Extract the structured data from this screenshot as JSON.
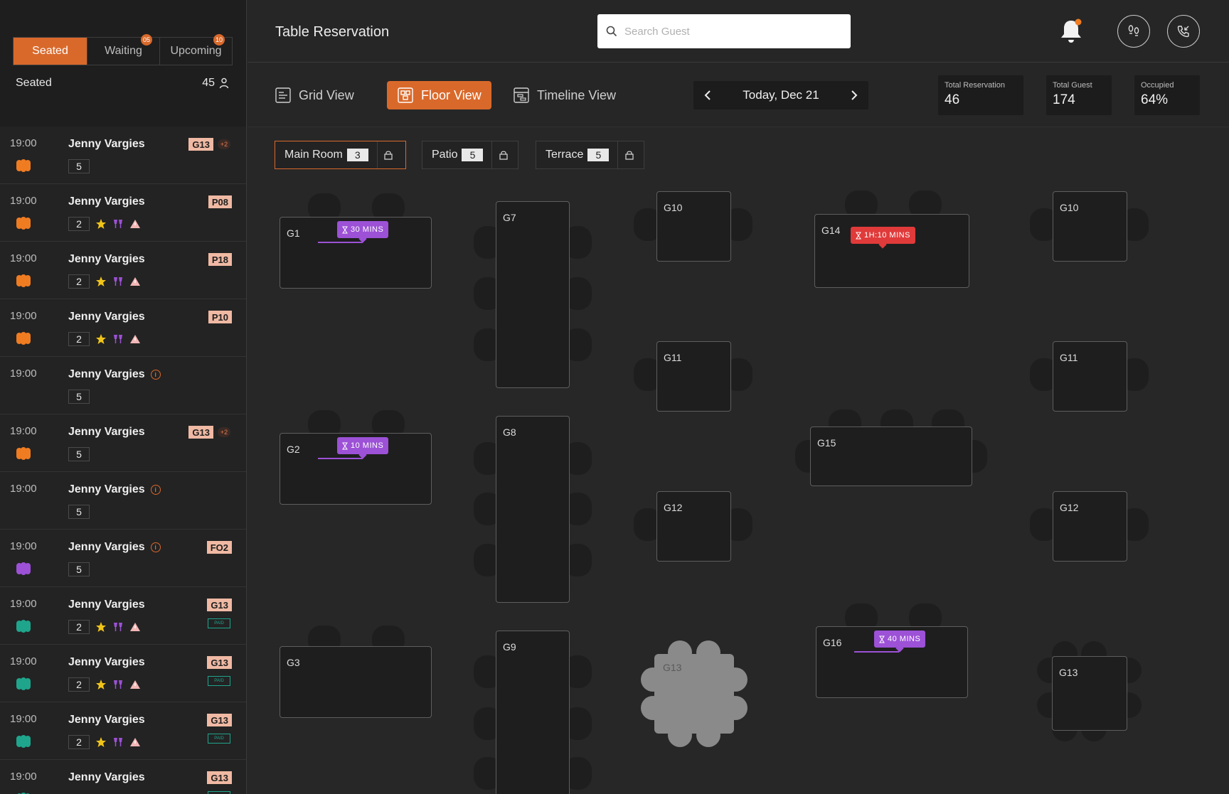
{
  "sidebar": {
    "tabs": [
      {
        "label": "Seated",
        "badge": ""
      },
      {
        "label": "Waiting",
        "badge": "05"
      },
      {
        "label": "Upcoming",
        "badge": "10"
      }
    ],
    "seated_label": "Seated",
    "seated_count": "45",
    "reservations": [
      {
        "time": "19:00",
        "name": "Jenny Vargies",
        "table": "G13",
        "extra": "+2",
        "guests": "5",
        "status_color": "#f07c22",
        "icons": false,
        "info": false,
        "paid": false
      },
      {
        "time": "19:00",
        "name": "Jenny Vargies",
        "table": "P08",
        "extra": "",
        "guests": "2",
        "status_color": "#f07c22",
        "icons": true,
        "info": false,
        "paid": false
      },
      {
        "time": "19:00",
        "name": "Jenny Vargies",
        "table": "P18",
        "extra": "",
        "guests": "2",
        "status_color": "#f07c22",
        "icons": true,
        "info": false,
        "paid": false
      },
      {
        "time": "19:00",
        "name": "Jenny Vargies",
        "table": "P10",
        "extra": "",
        "guests": "2",
        "status_color": "#f07c22",
        "icons": true,
        "info": false,
        "paid": false
      },
      {
        "time": "19:00",
        "name": "Jenny Vargies",
        "table": "",
        "extra": "",
        "guests": "5",
        "status_color": "",
        "icons": false,
        "info": true,
        "paid": false
      },
      {
        "time": "19:00",
        "name": "Jenny Vargies",
        "table": "G13",
        "extra": "+2",
        "guests": "5",
        "status_color": "#f07c22",
        "icons": false,
        "info": false,
        "paid": false
      },
      {
        "time": "19:00",
        "name": "Jenny Vargies",
        "table": "",
        "extra": "",
        "guests": "5",
        "status_color": "",
        "icons": false,
        "info": true,
        "paid": false
      },
      {
        "time": "19:00",
        "name": "Jenny Vargies",
        "table": "FO2",
        "extra": "",
        "guests": "5",
        "status_color": "#9c51d6",
        "icons": false,
        "info": true,
        "paid": false
      },
      {
        "time": "19:00",
        "name": "Jenny Vargies",
        "table": "G13",
        "extra": "",
        "guests": "2",
        "status_color": "#1fa58c",
        "icons": true,
        "info": false,
        "paid": true
      },
      {
        "time": "19:00",
        "name": "Jenny Vargies",
        "table": "G13",
        "extra": "",
        "guests": "2",
        "status_color": "#1fa58c",
        "icons": true,
        "info": false,
        "paid": true
      },
      {
        "time": "19:00",
        "name": "Jenny Vargies",
        "table": "G13",
        "extra": "",
        "guests": "2",
        "status_color": "#1fa58c",
        "icons": true,
        "info": false,
        "paid": true
      },
      {
        "time": "19:00",
        "name": "Jenny Vargies",
        "table": "G13",
        "extra": "",
        "guests": "",
        "status_color": "#1fa58c",
        "icons": false,
        "info": false,
        "paid": true
      }
    ],
    "paid_label": "PAID"
  },
  "header": {
    "title": "Table Reservation",
    "search_placeholder": "Search Guest"
  },
  "toolbar": {
    "views": [
      "Grid View",
      "Floor View",
      "Timeline View"
    ],
    "date": "Today, Dec 21",
    "stats": [
      {
        "label": "Total Reservation",
        "value": "46"
      },
      {
        "label": "Total Guest",
        "value": "174"
      },
      {
        "label": "Occupied",
        "value": "64%"
      }
    ]
  },
  "rooms": [
    {
      "name": "Main Room",
      "count": "3"
    },
    {
      "name": "Patio",
      "count": "5"
    },
    {
      "name": "Terrace",
      "count": "5"
    }
  ],
  "tables": {
    "G1": "G1",
    "G2": "G2",
    "G3": "G3",
    "G7": "G7",
    "G8": "G8",
    "G9": "G9",
    "G10a": "G10",
    "G11a": "G11",
    "G12a": "G12",
    "G13a": "G13",
    "G14": "G14",
    "G15": "G15",
    "G16": "G16",
    "G10b": "G10",
    "G11b": "G11",
    "G12b": "G12",
    "G13b": "G13"
  },
  "timers": {
    "g1": "30 MINS",
    "g2": "10 MINS",
    "g14": "1H:10 MINS",
    "g16": "40 MINS"
  },
  "colors": {
    "accent": "#d9692b",
    "purple": "#9c51d6",
    "red": "#e03a3a",
    "teal": "#1fa58c",
    "star": "#f0c419"
  },
  "notifications": {
    "unread": true
  }
}
